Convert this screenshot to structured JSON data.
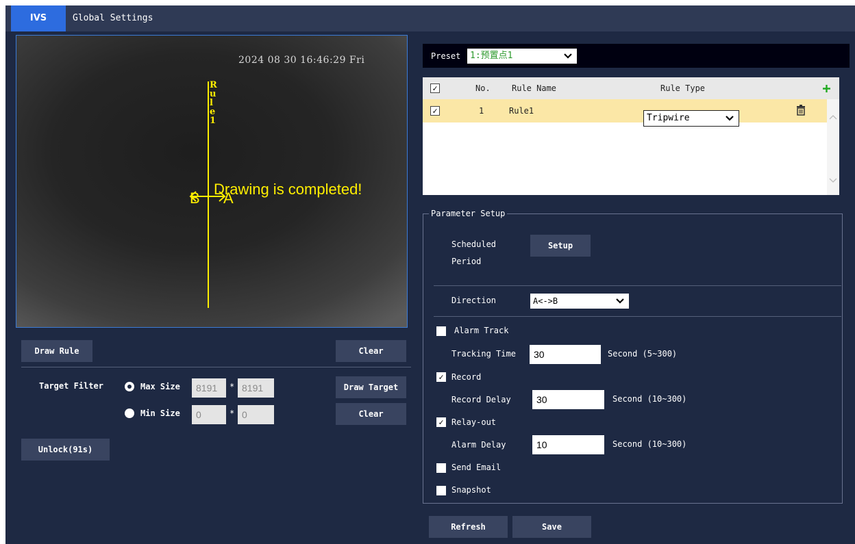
{
  "tabs": {
    "ivs": "IVS",
    "global": "Global Settings"
  },
  "video": {
    "timestamp": "2024 08 30 16:46:29 Fri",
    "rule_label_chars": [
      "R",
      "u",
      "l",
      "e",
      "1"
    ],
    "completed_msg": "Drawing is completed!",
    "side_b": "B",
    "side_a": "A"
  },
  "left": {
    "draw_rule": "Draw Rule",
    "clear_rule": "Clear",
    "target_filter": "Target Filter",
    "max_size": "Max Size",
    "min_size": "Min Size",
    "max_w": "8191",
    "max_h": "8191",
    "min_w": "0",
    "min_h": "0",
    "times": "*",
    "draw_target": "Draw Target",
    "clear_target": "Clear",
    "unlock": "Unlock(91s)"
  },
  "preset": {
    "label": "Preset",
    "value": "1:预置点1"
  },
  "rules": {
    "headers": {
      "no": "No.",
      "name": "Rule Name",
      "type": "Rule Type"
    },
    "add_icon": "plus-icon",
    "rows": [
      {
        "no": "1",
        "name": "Rule1",
        "type": "Tripwire"
      }
    ],
    "accent": "#22aa22",
    "row_highlight": "#fbe7a6"
  },
  "params": {
    "title": "Parameter Setup",
    "scheduled_line1": "Scheduled",
    "scheduled_line2": "Period",
    "setup": "Setup",
    "direction_label": "Direction",
    "direction_value": "A<->B",
    "alarm_track": "Alarm Track",
    "tracking_time_label": "Tracking Time",
    "tracking_time": "30",
    "tracking_range": "Second (5~300)",
    "record": "Record",
    "record_delay_label": "Record Delay",
    "record_delay": "30",
    "record_range": "Second (10~300)",
    "relay_out": "Relay-out",
    "alarm_delay_label": "Alarm Delay",
    "alarm_delay": "10",
    "alarm_range": "Second (10~300)",
    "send_email": "Send Email",
    "snapshot": "Snapshot"
  },
  "footer": {
    "refresh": "Refresh",
    "save": "Save"
  }
}
